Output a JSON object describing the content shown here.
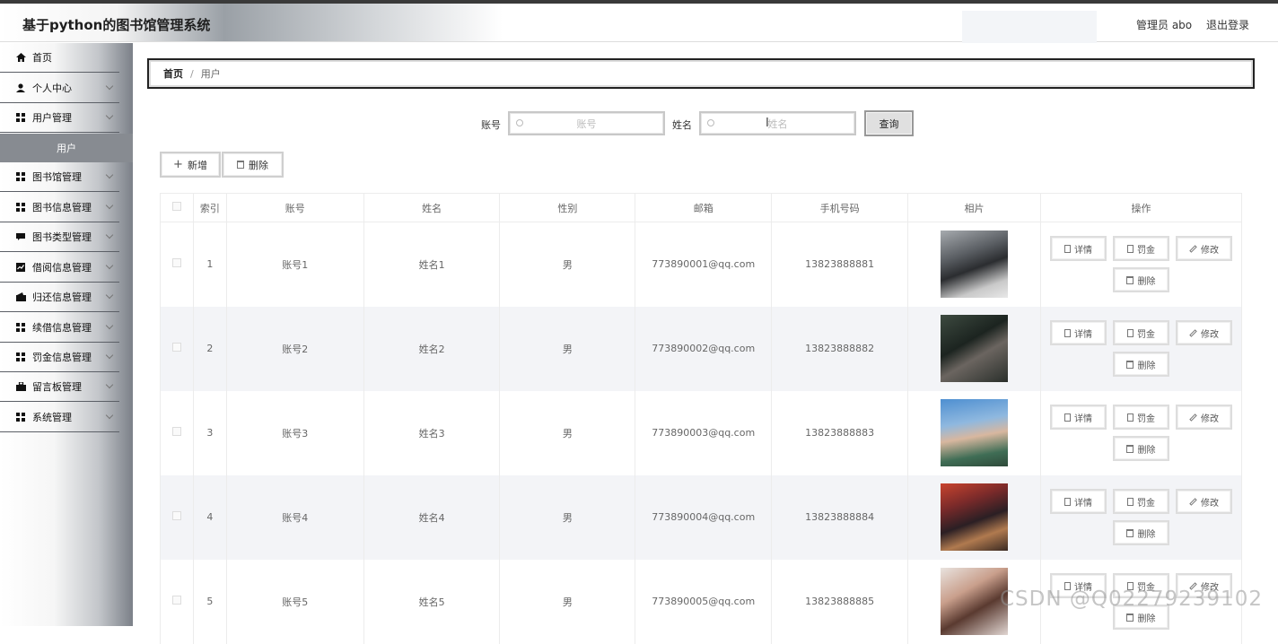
{
  "header": {
    "title": "基于python的图书馆管理系统",
    "user": "管理员 abo",
    "logout": "退出登录"
  },
  "sidebar": {
    "items": [
      {
        "label": "首页",
        "icon": "home-icon"
      },
      {
        "label": "个人中心",
        "icon": "person-icon"
      },
      {
        "label": "用户管理",
        "icon": "grid-icon"
      },
      {
        "label": "图书馆管理",
        "icon": "grid-icon"
      },
      {
        "label": "图书信息管理",
        "icon": "grid-icon"
      },
      {
        "label": "图书类型管理",
        "icon": "chat-icon"
      },
      {
        "label": "借阅信息管理",
        "icon": "chart-icon"
      },
      {
        "label": "归还信息管理",
        "icon": "wallet-icon"
      },
      {
        "label": "续借信息管理",
        "icon": "grid-icon"
      },
      {
        "label": "罚金信息管理",
        "icon": "grid-icon"
      },
      {
        "label": "留言板管理",
        "icon": "bag-icon"
      },
      {
        "label": "系统管理",
        "icon": "grid-icon"
      }
    ],
    "sub": "用户"
  },
  "breadcrumb": {
    "home": "首页",
    "sep": "/",
    "current": "用户"
  },
  "search": {
    "account_label": "账号",
    "account_placeholder": "账号",
    "name_label": "姓名",
    "name_placeholder": "姓名",
    "query": "查询"
  },
  "actions": {
    "add": "新增",
    "delete": "删除"
  },
  "table": {
    "headers": [
      "索引",
      "账号",
      "姓名",
      "性别",
      "邮箱",
      "手机号码",
      "相片",
      "操作"
    ],
    "rows": [
      {
        "index": "1",
        "account": "账号1",
        "name": "姓名1",
        "gender": "男",
        "email": "773890001@qq.com",
        "phone": "13823888881"
      },
      {
        "index": "2",
        "account": "账号2",
        "name": "姓名2",
        "gender": "男",
        "email": "773890002@qq.com",
        "phone": "13823888882"
      },
      {
        "index": "3",
        "account": "账号3",
        "name": "姓名3",
        "gender": "男",
        "email": "773890003@qq.com",
        "phone": "13823888883"
      },
      {
        "index": "4",
        "account": "账号4",
        "name": "姓名4",
        "gender": "男",
        "email": "773890004@qq.com",
        "phone": "13823888884"
      },
      {
        "index": "5",
        "account": "账号5",
        "name": "姓名5",
        "gender": "男",
        "email": "773890005@qq.com",
        "phone": "13823888885"
      }
    ],
    "ops": {
      "detail": "详情",
      "fine": "罚金",
      "edit": "修改",
      "delete": "删除"
    }
  },
  "watermark": "CSDN @Q02279239102"
}
